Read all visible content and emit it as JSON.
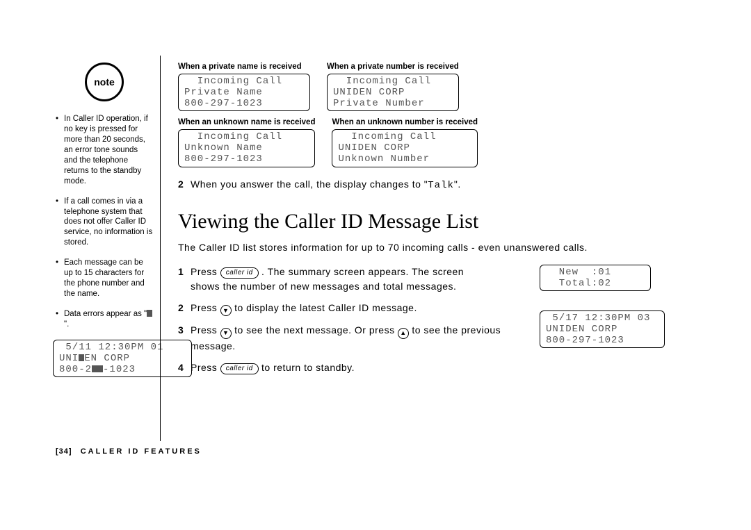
{
  "sidebar": {
    "badge": "note",
    "items": [
      "In Caller ID operation, if no key is pressed for more than 20 seconds, an error tone sounds and the telephone returns to the standby mode.",
      "If a call comes in via a telephone system that does not offer Caller ID service, no information is stored.",
      "Each message can be up to 15 characters for the phone number and the name.",
      "Data errors appear as \""
    ],
    "err_suffix": "\".",
    "err_lcd": {
      "l1": " 5/11 12:30PM 01",
      "l2a": "UNI",
      "l2b": "EN CORP",
      "l3a": "800-2",
      "l3b": "-1023"
    }
  },
  "displays": {
    "group1": {
      "left": {
        "cap": "When a private name is received",
        "l1": "  Incoming Call",
        "l2": "Private Name",
        "l3": "800-297-1023"
      },
      "right": {
        "cap": "When a private number is received",
        "l1": "  Incoming Call",
        "l2": "UNIDEN CORP",
        "l3": "Private Number"
      }
    },
    "group2": {
      "left": {
        "cap": "When an unknown name is received",
        "l1": "  Incoming Call",
        "l2": "Unknown Name",
        "l3": "800-297-1023"
      },
      "right": {
        "cap": "When an unknown number is received",
        "l1": "  Incoming Call",
        "l2": "UNIDEN CORP",
        "l3": "Unknown Number"
      }
    }
  },
  "step_intro": {
    "num": "2",
    "a": "When you answer the call, the display changes to \"",
    "b": "Talk",
    "c": "\"."
  },
  "heading": "Viewing the Caller ID Message List",
  "intro": "The Caller ID list stores information for up to 70 incoming calls - even unanswered calls.",
  "steps": {
    "s1": {
      "num": "1",
      "a": "Press ",
      "key": "caller id",
      "b": " . The summary screen appears. The screen shows the number of new messages and total messages."
    },
    "s2": {
      "num": "2",
      "a": "Press ",
      "b": " to display the latest Caller ID message."
    },
    "s3": {
      "num": "3",
      "a": "Press ",
      "b": " to see the next message. Or press ",
      "c": " to see the previous message."
    },
    "s4": {
      "num": "4",
      "a": "Press ",
      "key": "caller id",
      "b": "  to return to standby."
    }
  },
  "float_lcds": {
    "summary": {
      "l1": "  New  :01",
      "l2": "  Total:02"
    },
    "msg": {
      "l1": " 5/17 12:30PM 03",
      "l2": "UNIDEN CORP",
      "l3": "800-297-1023"
    }
  },
  "footer": {
    "pg": "[34]",
    "label": "CALLER ID FEATURES"
  }
}
